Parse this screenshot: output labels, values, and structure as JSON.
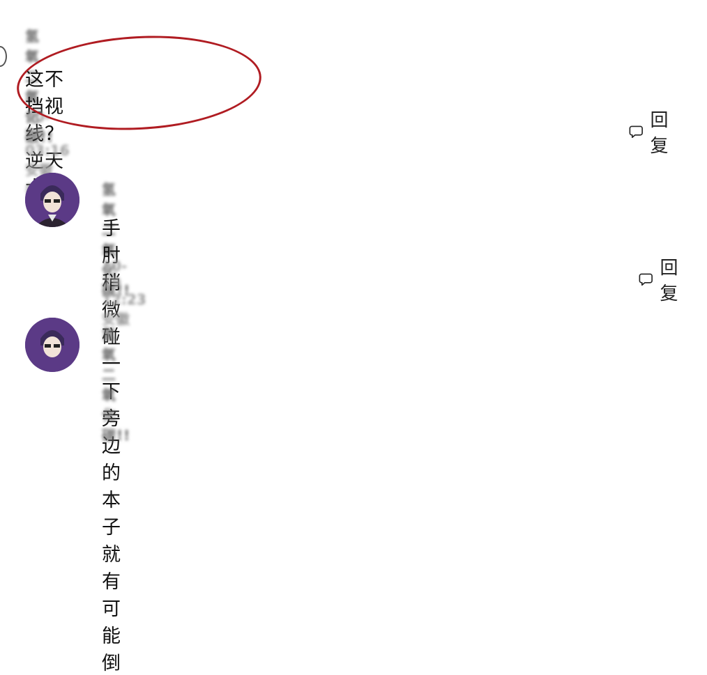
{
  "comments": [
    {
      "username": "氢氧二氧化碳!!",
      "text": "这不挡视线？逆天大专",
      "meta": "10-29 03:16 安徽 举报",
      "reply_label": "回复"
    }
  ],
  "replies": [
    {
      "username": "氢氧二氧化碳!!",
      "text": "手肘稍微碰一下旁边的本子就有可能倒",
      "meta": "10-29 12:23 安徽",
      "reply_label": "回复"
    },
    {
      "username": "氢氧二氧化碳!!"
    }
  ],
  "colors": {
    "highlight_circle": "#b01c22",
    "avatar_bg": "#5b3a86"
  },
  "icons": [
    "speech-bubble-icon",
    "avatar-icon"
  ]
}
